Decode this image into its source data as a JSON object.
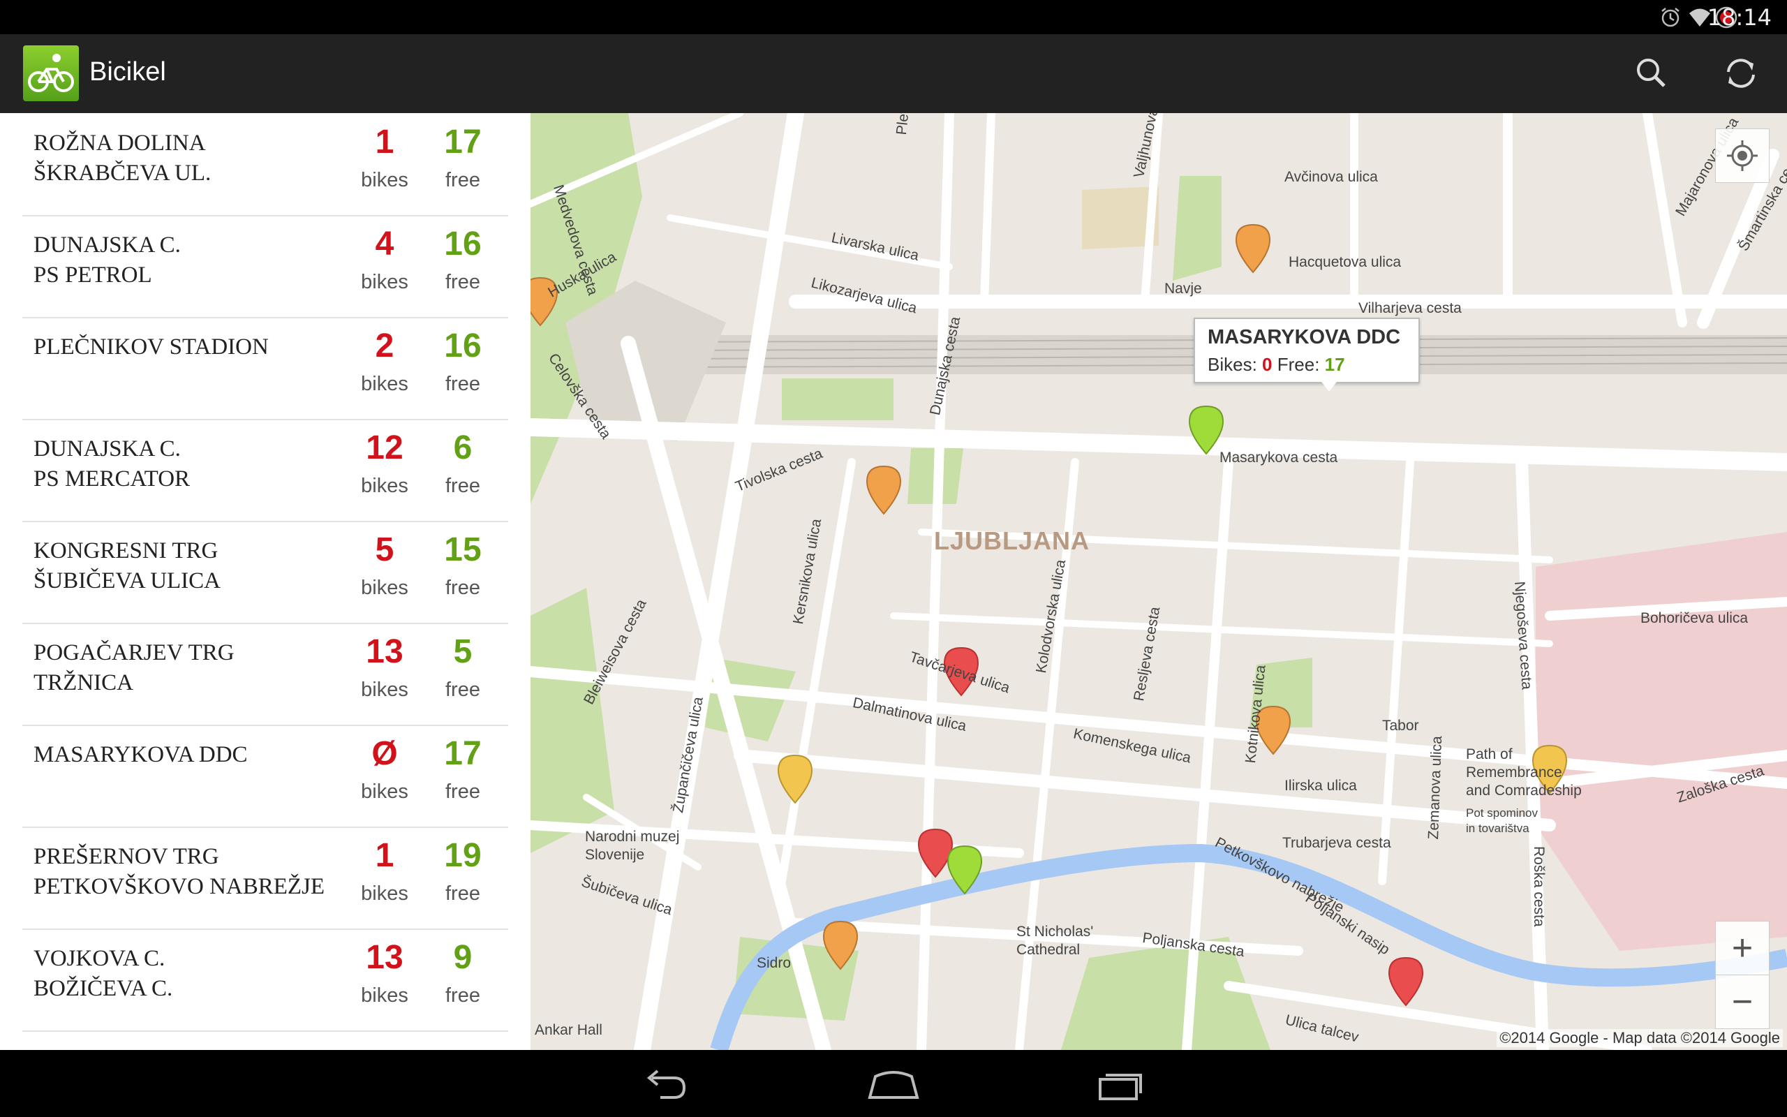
{
  "status_bar": {
    "time": "18:14",
    "icons": [
      "alarm-icon",
      "wifi-icon",
      "battery-icon"
    ],
    "battery_level": "5"
  },
  "action_bar": {
    "title": "Bicikel",
    "app_icon": "bicycle-icon",
    "search_icon": "search-icon",
    "refresh_icon": "refresh-icon"
  },
  "colors": {
    "bikes": "#d1121b",
    "free": "#62a015",
    "action_bar": "#222222",
    "marker_red": "#e94d4d",
    "marker_orange": "#f0a14a",
    "marker_yellow": "#f2c54e",
    "marker_green": "#9fdc3a"
  },
  "stations": [
    {
      "name": "ROŽNA DOLINA\nŠKRABČEVA UL.",
      "bikes": "1",
      "free": "17",
      "bikes_label": "bikes",
      "free_label": "free"
    },
    {
      "name": "DUNAJSKA C.\nPS PETROL",
      "bikes": "4",
      "free": "16",
      "bikes_label": "bikes",
      "free_label": "free"
    },
    {
      "name": "PLEČNIKOV STADION",
      "bikes": "2",
      "free": "16",
      "bikes_label": "bikes",
      "free_label": "free"
    },
    {
      "name": "DUNAJSKA C.\nPS MERCATOR",
      "bikes": "12",
      "free": "6",
      "bikes_label": "bikes",
      "free_label": "free"
    },
    {
      "name": "KONGRESNI TRG\nŠUBIČEVA ULICA",
      "bikes": "5",
      "free": "15",
      "bikes_label": "bikes",
      "free_label": "free"
    },
    {
      "name": "POGAČARJEV TRG\nTRŽNICA",
      "bikes": "13",
      "free": "5",
      "bikes_label": "bikes",
      "free_label": "free"
    },
    {
      "name": "MASARYKOVA DDC",
      "bikes": "Ø",
      "free": "17",
      "bikes_label": "bikes",
      "free_label": "free"
    },
    {
      "name": "PREŠERNOV TRG\nPETKOVŠKOVO NABREŽJE",
      "bikes": "1",
      "free": "19",
      "bikes_label": "bikes",
      "free_label": "free"
    },
    {
      "name": "VOJKOVA C.\nBOŽIČEVA C.",
      "bikes": "13",
      "free": "9",
      "bikes_label": "bikes",
      "free_label": "free"
    }
  ],
  "map": {
    "city_label": "LJUBLJANA",
    "info_window": {
      "title": "MASARYKOVA DDC",
      "bikes_label": "Bikes:",
      "bikes": "0",
      "free_label": "Free:",
      "free": "17"
    },
    "copyright": "©2014 Google - Map data ©2014 Google",
    "street_labels": [
      "Medvedova cesta",
      "Pleteršnikova ulica",
      "Livarska ulica",
      "Likozarjeva ulica",
      "Valjhunova ulica",
      "Navje",
      "Avčinova ulica",
      "Hacquetova ulica",
      "Vilharjeva cesta",
      "Huska ulica",
      "Celovška cesta",
      "Dunajska cesta",
      "Tivolska cesta",
      "Masarykova cesta",
      "Majaronova ulica",
      "Šmartinska cesta",
      "Kersnikova ulica",
      "Bleiweisova cesta",
      "Tavčarjeva ulica",
      "Dalmatinova ulica",
      "Kolodvorska ulica",
      "Resljeva cesta",
      "Komenskega ulica",
      "Kotnikova ulica",
      "Tabor",
      "Njegoševa cesta",
      "Bohoričeva ulica",
      "Župančičeva ulica",
      "Ilirska ulica",
      "Trubarjeva cesta",
      "Petkovškovo nabrežje",
      "Poljanski nasip",
      "Zaloška cesta",
      "Narodni muzej\nSlovenije",
      "Šubičeva ulica",
      "St Nicholas'\nCathedral",
      "Poljanska cesta",
      "Sidro",
      "Ulica talcev",
      "Roška cesta",
      "Zemanova ulica",
      "Path of\nRemembrance\nand Comradeship",
      "Pot spominov\nin tovarištva",
      "Ankar Hall"
    ],
    "marker_icon": "map-pin-icon",
    "my_location_icon": "my-location-icon",
    "zoom_in_label": "+",
    "zoom_out_label": "−"
  },
  "nav_bar": {
    "icons": [
      "back-icon",
      "home-icon",
      "recent-apps-icon"
    ]
  }
}
